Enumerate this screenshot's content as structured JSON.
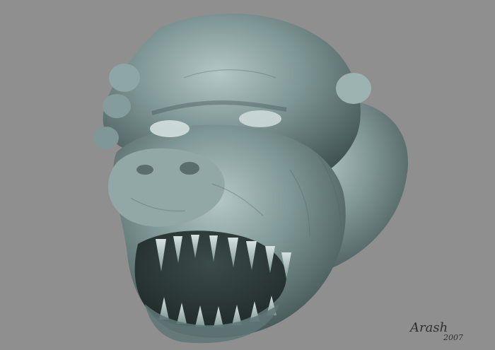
{
  "scene": {
    "subject": "creature-head-sculpt",
    "background_color": "#8f8f8f",
    "model_color": "#6f8786",
    "highlight_color": "#b4c7c6",
    "shadow_color": "#3f5150"
  },
  "signature": {
    "name": "Arash",
    "year": "2007"
  }
}
